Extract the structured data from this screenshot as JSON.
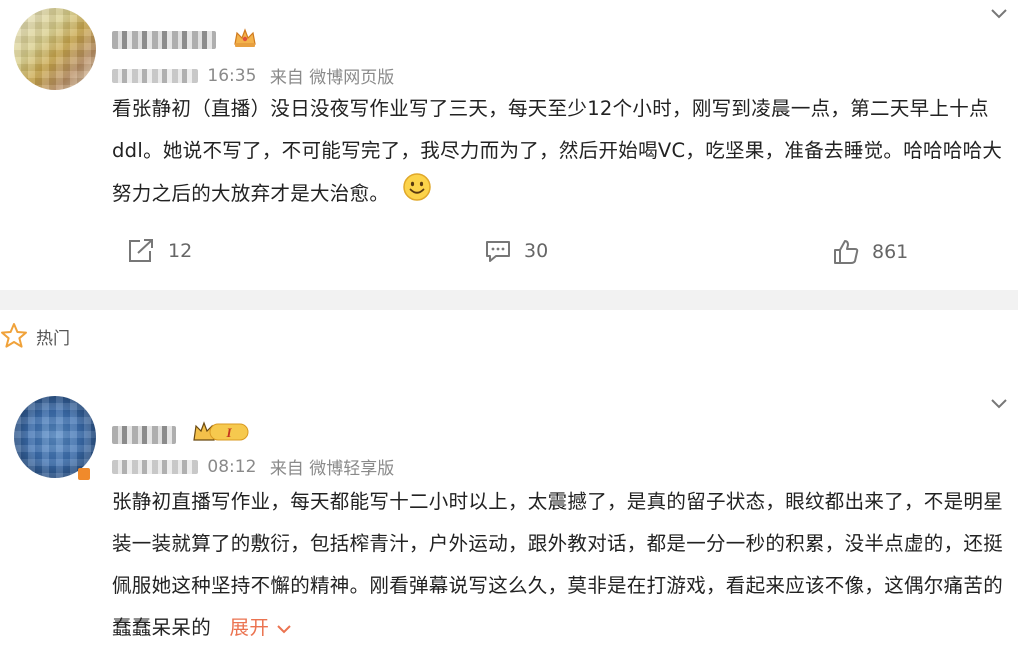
{
  "post1": {
    "username": "",
    "time": "16:35",
    "source": "来自 微博网页版",
    "text": "看张静初（直播）没日没夜写作业写了三天，每天至少12个小时，刚写到凌晨一点，第二天早上十点ddl。她说不写了，不可能写完了，我尽力而为了，然后开始喝VC，吃坚果，准备去睡觉。哈哈哈哈大努力之后的大放弃才是大治愈。",
    "emoji": "smile-emoji",
    "repost_count": "12",
    "comment_count": "30",
    "like_count": "861"
  },
  "section_label": "热门",
  "post2": {
    "time": "08:12",
    "source": "来自 微博轻享版",
    "text": "张静初直播写作业，每天都能写十二小时以上，太震撼了，是真的留子状态，眼纹都出来了，不是明星装一装就算了的敷衍，包括榨青汁，户外运动，跟外教对话，都是一分一秒的积累，没半点虚的，还挺佩服她这种坚持不懈的精神。刚看弹幕说写这么久，莫非是在打游戏，看起来应该不像，这偶尔痛苦的蠢蠢呆呆的",
    "expand_label": "展开",
    "vip_badge_text": "I"
  },
  "colors": {
    "accent": "#eb7350",
    "meta": "#8a8a8a",
    "divider": "#f2f2f2"
  },
  "icons": [
    "repost-icon",
    "comment-icon",
    "like-icon",
    "star-icon",
    "chevron-down-icon",
    "crown-badge-icon",
    "vip-level-badge-icon"
  ]
}
